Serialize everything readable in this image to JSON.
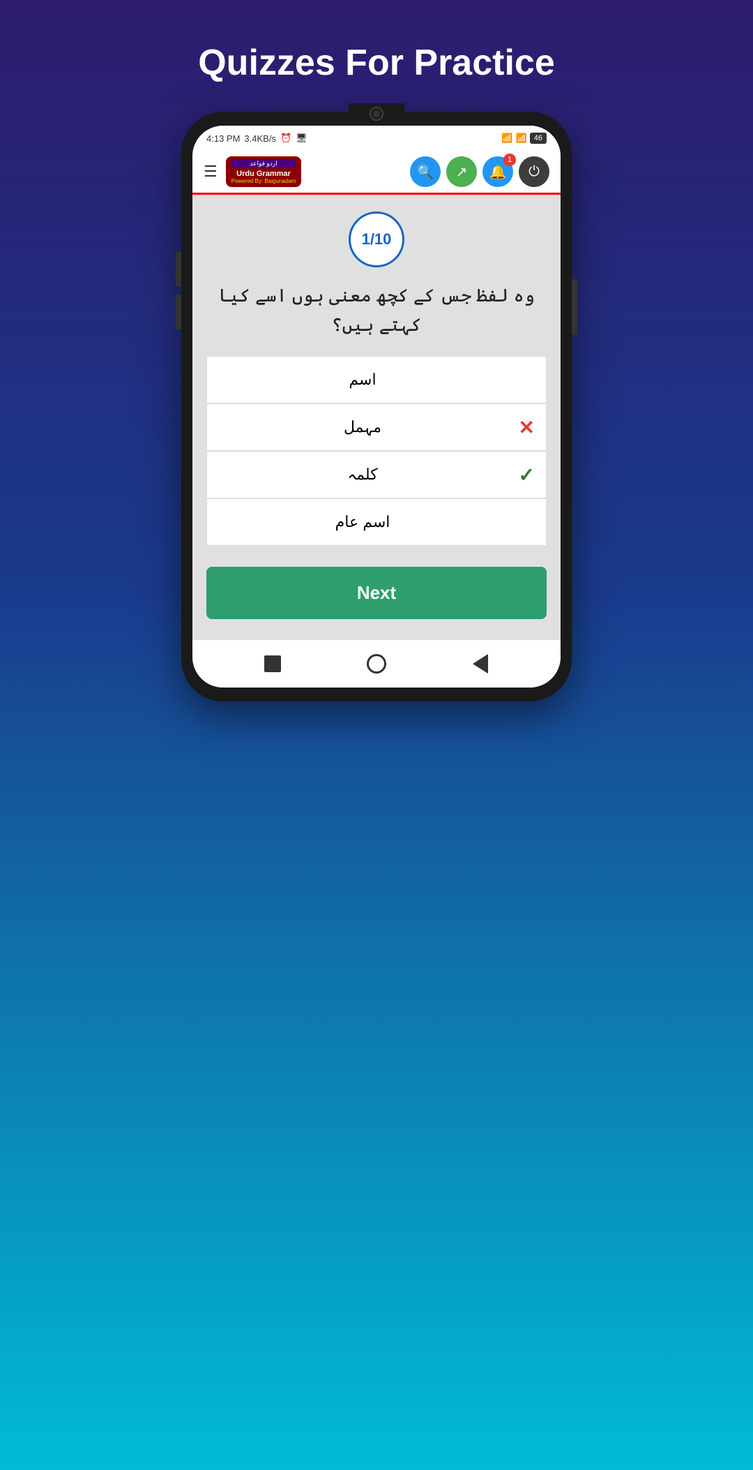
{
  "page": {
    "title": "Quizzes For Practice",
    "background_gradient_start": "#2d1b6e",
    "background_gradient_end": "#00bcd4"
  },
  "status_bar": {
    "time": "4:13 PM",
    "data_speed": "3.4KB/s",
    "battery": "46"
  },
  "header": {
    "logo_top": "اردو قواعد",
    "logo_main": "Urdu Grammar",
    "logo_sub": "Powered By: Baigunadam",
    "notification_count": "1"
  },
  "quiz": {
    "counter": "1/10",
    "question": "وہ لفظ جس کے کچھ معنی ہوں اسے کیا کہتے ہیں؟",
    "options": [
      {
        "text": "اسم",
        "state": "neutral"
      },
      {
        "text": "مہمل",
        "state": "wrong"
      },
      {
        "text": "کلمہ",
        "state": "correct"
      },
      {
        "text": "اسم عام",
        "state": "neutral"
      }
    ],
    "next_button": "Next"
  },
  "bottom_nav": {
    "back_label": "back",
    "home_label": "home",
    "square_label": "recent"
  }
}
